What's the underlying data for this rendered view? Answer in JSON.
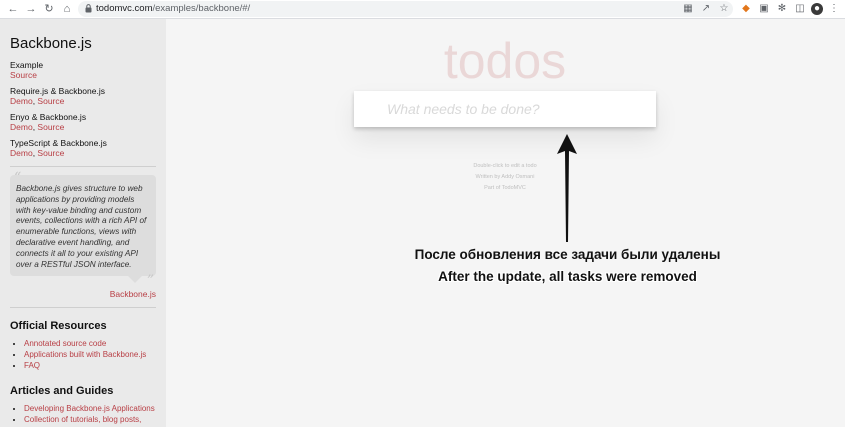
{
  "browser": {
    "url_host": "todomvc.com",
    "url_path": "/examples/backbone/#/"
  },
  "sidebar": {
    "title": "Backbone.js",
    "examples": [
      {
        "name": "Example",
        "links": [
          "Source"
        ]
      },
      {
        "name": "Require.js & Backbone.js",
        "links": [
          "Demo",
          "Source"
        ]
      },
      {
        "name": "Enyo & Backbone.js",
        "links": [
          "Demo",
          "Source"
        ]
      },
      {
        "name": "TypeScript & Backbone.js",
        "links": [
          "Demo",
          "Source"
        ]
      }
    ],
    "quote": "Backbone.js gives structure to web applications by providing models with key-value binding and custom events, collections with a rich API of enumerable functions, views with declarative event handling, and connects it all to your existing API over a RESTful JSON interface.",
    "quote_source": "Backbone.js",
    "official_resources_title": "Official Resources",
    "official_resources": [
      "Annotated source code",
      "Applications built with Backbone.js",
      "FAQ"
    ],
    "articles_title": "Articles and Guides",
    "articles": [
      "Developing Backbone.js Applications",
      "Collection of tutorials, blog posts, and"
    ]
  },
  "app": {
    "title": "todos",
    "new_todo_placeholder": "What needs to be done?",
    "new_todo_value": "",
    "info": [
      "Double-click to edit a todo",
      "Written by Addy Osmani",
      "Part of TodoMVC"
    ]
  },
  "annotation": {
    "caption_ru": "После обновления все задачи были удалены",
    "caption_en": "After the update, all tasks were removed"
  },
  "colors": {
    "accent": "#b83f45",
    "title": "#ead7d7",
    "sidebar_bg": "#eaeaea",
    "page_bg": "#f5f5f5"
  }
}
